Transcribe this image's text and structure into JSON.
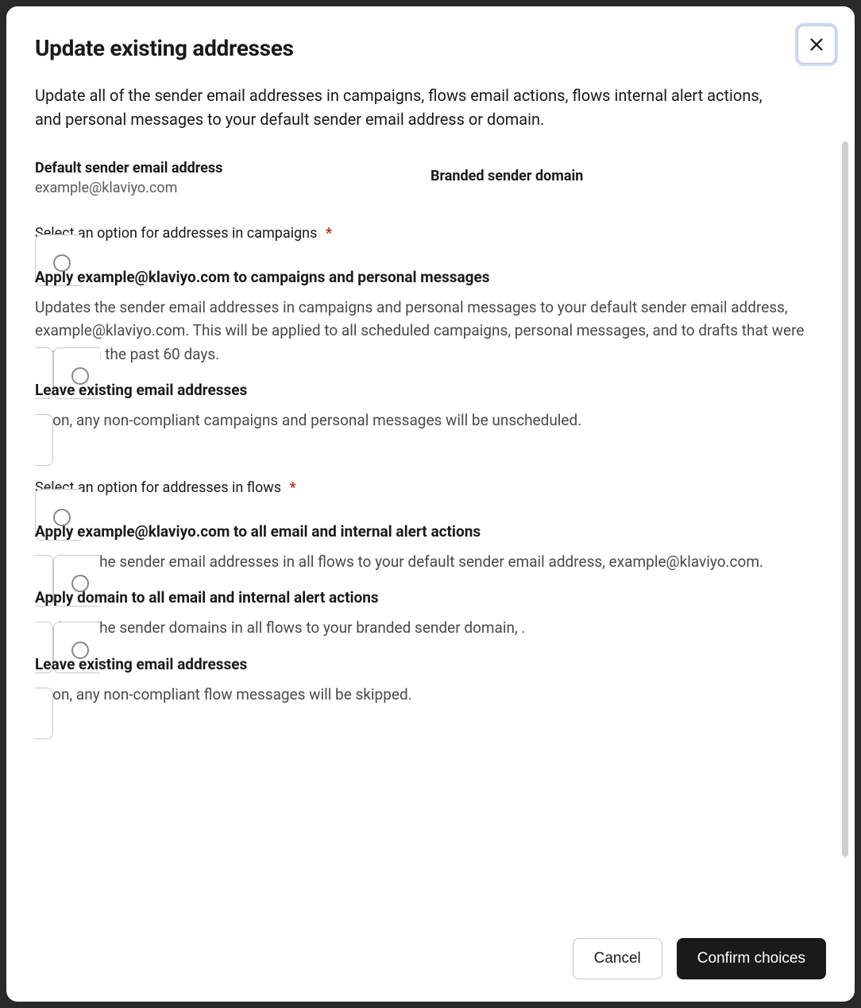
{
  "modal": {
    "title": "Update existing addresses",
    "description": "Update all of the sender email addresses in campaigns, flows email actions, flows internal alert actions, and personal messages to your default sender email address or domain.",
    "default_email_label": "Default sender email address",
    "default_email_value": "example@klaviyo.com",
    "branded_domain_label": "Branded sender domain",
    "campaigns": {
      "section_label": "Select an option for addresses in campaigns",
      "required_marker": "*",
      "options": [
        {
          "title": "Apply example@klaviyo.com to campaigns and personal messages",
          "description": "Updates the sender email addresses in campaigns and personal messages to your default sender email address, example@klaviyo.com. This will be applied to all scheduled campaigns, personal messages, and to drafts that were created in the past 60 days."
        },
        {
          "title": "Leave existing email addresses",
          "description": "Soon, any non-compliant campaigns and personal messages will be unscheduled."
        }
      ]
    },
    "flows": {
      "section_label": "Select an option for addresses in flows",
      "required_marker": "*",
      "options": [
        {
          "title": "Apply example@klaviyo.com to all email and internal alert actions",
          "description": "Updates the sender email addresses in all flows to your default sender email address, example@klaviyo.com."
        },
        {
          "title": "Apply domain to all email and internal alert actions",
          "description": "Updates the sender domains in all flows to your branded sender domain, ."
        },
        {
          "title": "Leave existing email addresses",
          "description": "Soon, any non-compliant flow messages will be skipped."
        }
      ]
    },
    "footer": {
      "cancel_label": "Cancel",
      "confirm_label": "Confirm choices"
    }
  }
}
